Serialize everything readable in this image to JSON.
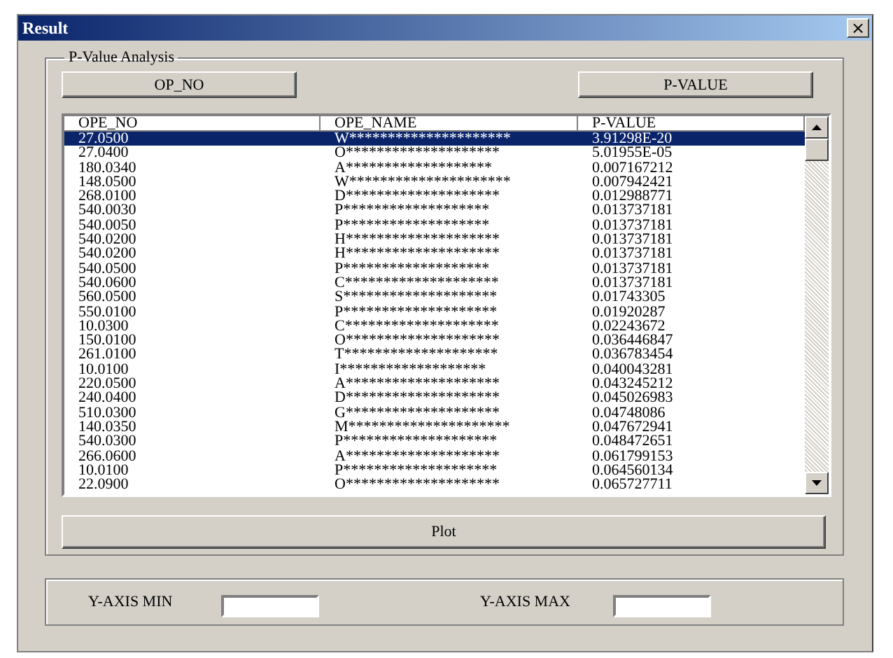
{
  "window": {
    "title": "Result",
    "close": "×"
  },
  "group": {
    "title": "P-Value Analysis"
  },
  "sort_buttons": [
    "OP_NO",
    "P-VALUE"
  ],
  "table": {
    "columns": [
      "OPE_NO",
      "OPE_NAME",
      "P-VALUE"
    ],
    "rows": [
      {
        "cells": [
          "27.0500",
          "W*********************",
          "3.91298E-20"
        ],
        "selected": true
      },
      {
        "cells": [
          "27.0400",
          "O********************",
          "5.01955E-05"
        ],
        "selected": false
      },
      {
        "cells": [
          "180.0340",
          "A*******************",
          "0.007167212"
        ],
        "selected": false
      },
      {
        "cells": [
          "148.0500",
          "W*********************",
          "0.007942421"
        ],
        "selected": false
      },
      {
        "cells": [
          "268.0100",
          "D********************",
          "0.012988771"
        ],
        "selected": false
      },
      {
        "cells": [
          "540.0030",
          "P*******************",
          "0.013737181"
        ],
        "selected": false
      },
      {
        "cells": [
          "540.0050",
          "P*******************",
          "0.013737181"
        ],
        "selected": false
      },
      {
        "cells": [
          "540.0200",
          "H********************",
          "0.013737181"
        ],
        "selected": false
      },
      {
        "cells": [
          "540.0200",
          "H********************",
          "0.013737181"
        ],
        "selected": false
      },
      {
        "cells": [
          "540.0500",
          "P*******************",
          "0.013737181"
        ],
        "selected": false
      },
      {
        "cells": [
          "540.0600",
          "C********************",
          "0.013737181"
        ],
        "selected": false
      },
      {
        "cells": [
          "560.0500",
          "S********************",
          "0.01743305"
        ],
        "selected": false
      },
      {
        "cells": [
          "550.0100",
          "P********************",
          "0.01920287"
        ],
        "selected": false
      },
      {
        "cells": [
          "10.0300",
          "C********************",
          "0.02243672"
        ],
        "selected": false
      },
      {
        "cells": [
          "150.0100",
          "O********************",
          "0.036446847"
        ],
        "selected": false
      },
      {
        "cells": [
          "261.0100",
          "T********************",
          "0.036783454"
        ],
        "selected": false
      },
      {
        "cells": [
          "10.0100",
          "I*******************",
          "0.040043281"
        ],
        "selected": false
      },
      {
        "cells": [
          "220.0500",
          "A********************",
          "0.043245212"
        ],
        "selected": false
      },
      {
        "cells": [
          "240.0400",
          "D********************",
          "0.045026983"
        ],
        "selected": false
      },
      {
        "cells": [
          "510.0300",
          "G********************",
          "0.04748086"
        ],
        "selected": false
      },
      {
        "cells": [
          "140.0350",
          "M*********************",
          "0.047672941"
        ],
        "selected": false
      },
      {
        "cells": [
          "540.0300",
          "P********************",
          "0.048472651"
        ],
        "selected": false
      },
      {
        "cells": [
          "266.0600",
          "A********************",
          "0.061799153"
        ],
        "selected": false
      },
      {
        "cells": [
          "10.0100",
          "P********************",
          "0.064560134"
        ],
        "selected": false
      },
      {
        "cells": [
          "22.0900",
          "O********************",
          "0.065727711"
        ],
        "selected": false
      }
    ]
  },
  "plot_button": "Plot",
  "axis_fields": [
    {
      "label": "Y-AXIS MIN"
    },
    {
      "label": "Y-AXIS MAX"
    }
  ]
}
